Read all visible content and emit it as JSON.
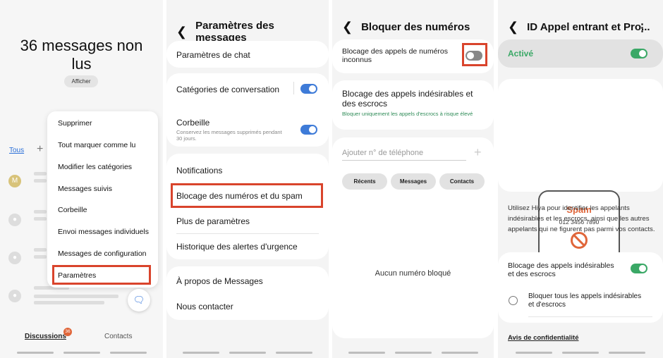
{
  "panel1": {
    "unread_title": "36 messages non lus",
    "show_button": "Afficher",
    "filter_all": "Tous",
    "add_filter": "+",
    "avatar_letter": "M",
    "menu": [
      "Supprimer",
      "Tout marquer comme lu",
      "Modifier les catégories",
      "Messages suivis",
      "Corbeille",
      "Envoi messages individuels",
      "Messages de configuration",
      "Paramètres"
    ],
    "tab_discussions": "Discussions",
    "tab_contacts": "Contacts",
    "badge_count": "36"
  },
  "panel2": {
    "title": "Paramètres des messages",
    "chat_settings": "Paramètres de chat",
    "conv_categories": "Catégories de conversation",
    "trash": "Corbeille",
    "trash_sub": "Conservez les messages supprimés pendant 30 jours.",
    "notifications": "Notifications",
    "block": "Blocage des numéros et du spam",
    "more": "Plus de paramètres",
    "emergency": "Historique des alertes d'urgence",
    "about": "À propos de Messages",
    "contact": "Nous contacter"
  },
  "panel3": {
    "title": "Bloquer des numéros",
    "unknown": "Blocage des appels de numéros inconnus",
    "spam": "Blocage des appels indésirables et des escrocs",
    "spam_sub": "Bloquer uniquement les appels d'escrocs à risque élevé",
    "add_placeholder": "Ajouter n° de téléphone",
    "add_icon": "+",
    "recents": "Récents",
    "messages": "Messages",
    "contacts": "Contacts",
    "empty": "Aucun numéro bloqué"
  },
  "panel4": {
    "title": "ID Appel entrant et Pro...",
    "more_icon": "⋮",
    "active": "Activé",
    "spam_label": "Spam",
    "spam_number": "012 3456 7890",
    "description": "Utilisez Hiya pour identifier les appelants indésirables et les escrocs, ainsi que les autres appelants qui ne figurent pas parmi vos contacts.",
    "block_spam": "Blocage des appels indésirables et des escrocs",
    "block_all": "Bloquer tous les appels indésirables et d'escrocs",
    "privacy": "Avis de confidentialité"
  },
  "colors": {
    "accent_blue": "#3e7bd8",
    "accent_green": "#3aa866",
    "highlight_red": "#d9442c"
  },
  "icons": [
    "chevron-left-icon",
    "chat-fab-icon",
    "block-icon",
    "more-vert-icon"
  ]
}
